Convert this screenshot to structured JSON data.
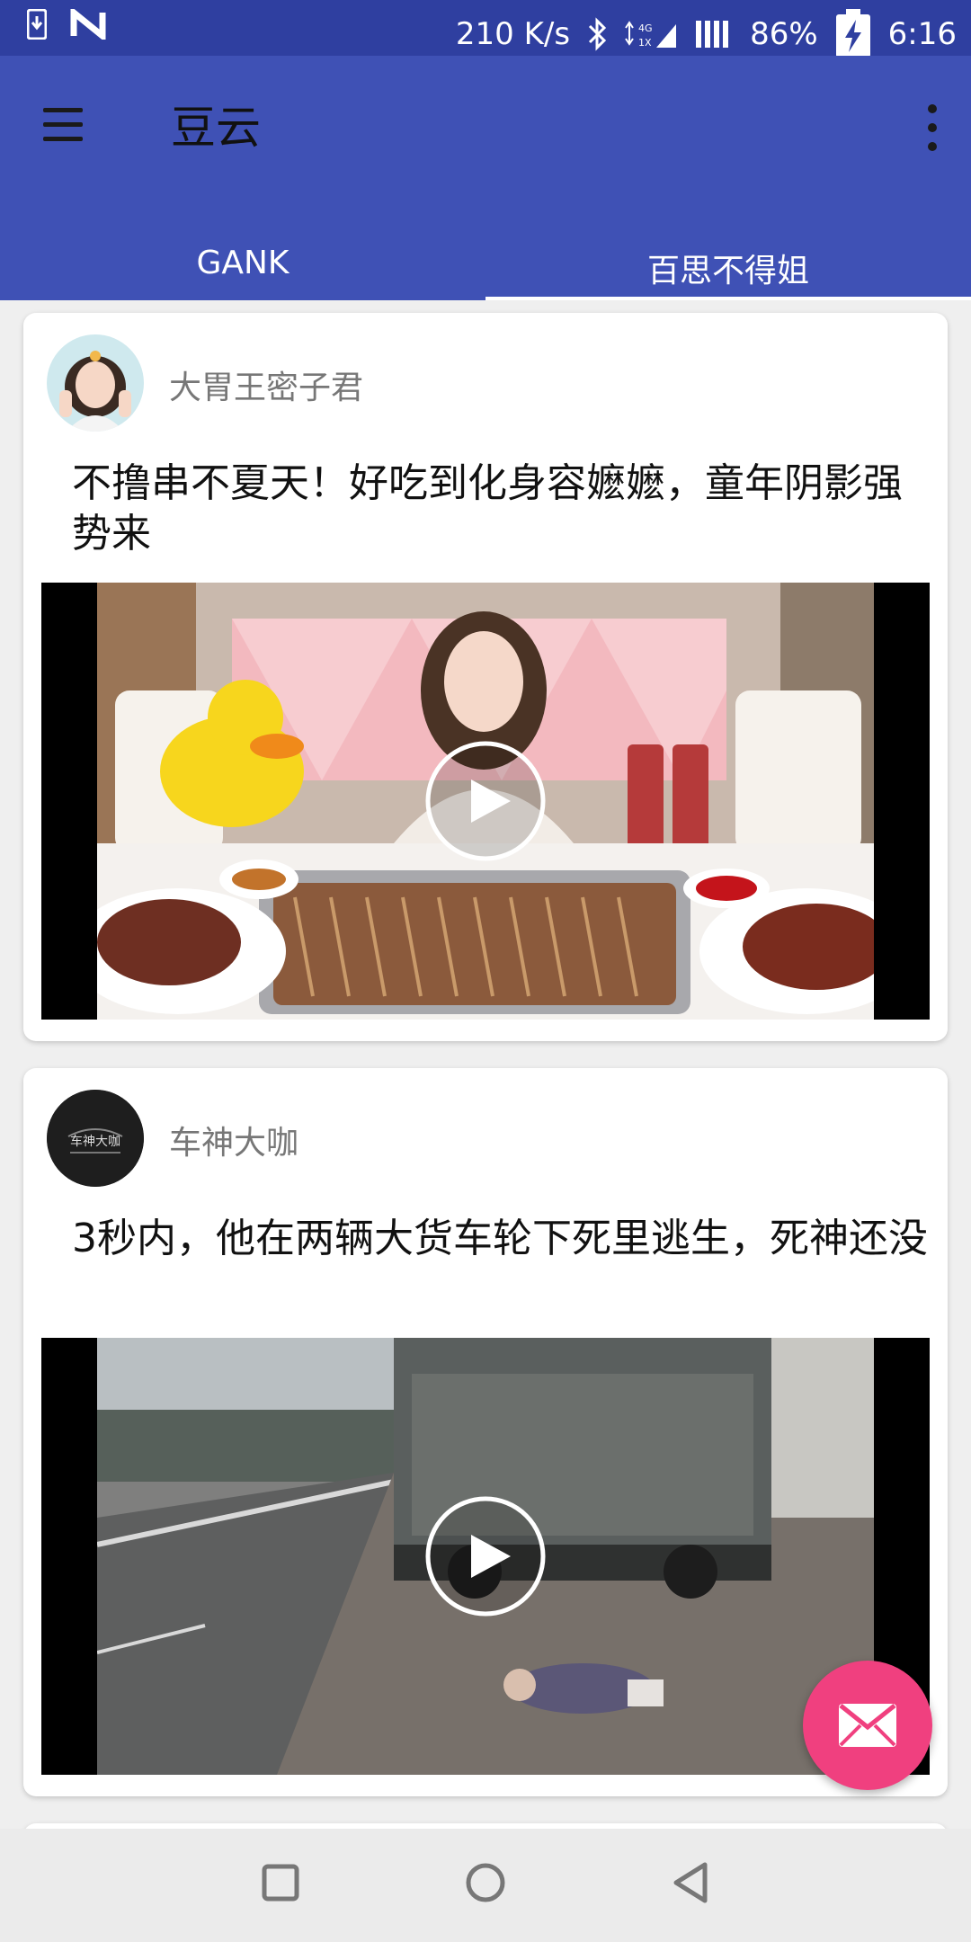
{
  "status_bar": {
    "net_speed": "210 K/s",
    "battery": "86%",
    "time": "6:16"
  },
  "app_bar": {
    "title": "豆云",
    "tabs": [
      {
        "label": "GANK",
        "active": false
      },
      {
        "label": "百思不得姐",
        "active": true
      }
    ]
  },
  "feed": [
    {
      "author": "大胃王密子君",
      "title": "不撸串不夏天！好吃到化身容嬷嬷，童年阴影强势来"
    },
    {
      "author": "车神大咖",
      "title": "3秒内，他在两辆大货车轮下死里逃生，死神还没",
      "avatar_text": "车神大咖"
    }
  ],
  "fab": {
    "icon": "mail-icon"
  },
  "colors": {
    "primary": "#3f51b5",
    "status_bar": "#2f3fa0",
    "accent": "#f0407f"
  }
}
